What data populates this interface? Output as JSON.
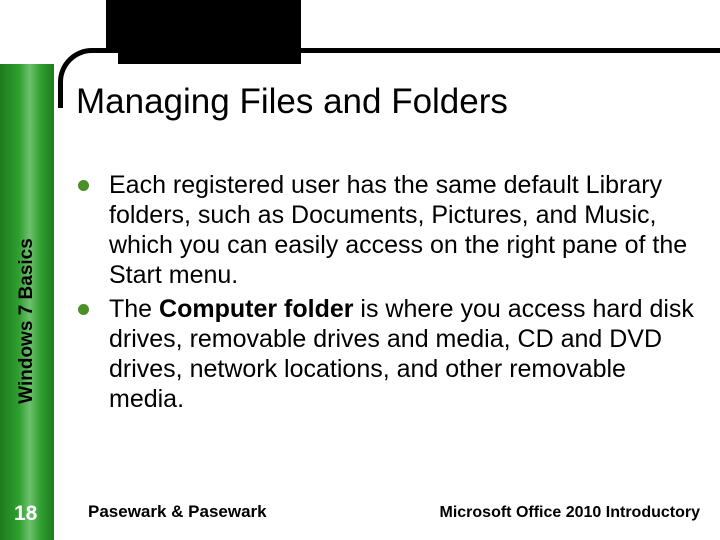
{
  "sidebar_label": "Windows 7 Basics",
  "title": "Managing Files and Folders",
  "bullets": [
    {
      "text": "Each registered user has the same default Library folders, such as Documents, Pictures, and Music, which you can easily access on the right pane of the Start menu."
    },
    {
      "prefix": "The ",
      "bold": "Computer folder",
      "suffix": " is where you access hard disk drives, removable drives and media, CD and DVD drives, network locations, and other removable media."
    }
  ],
  "page_number": "18",
  "footer_left": "Pasewark & Pasewark",
  "footer_right": "Microsoft Office 2010 Introductory"
}
